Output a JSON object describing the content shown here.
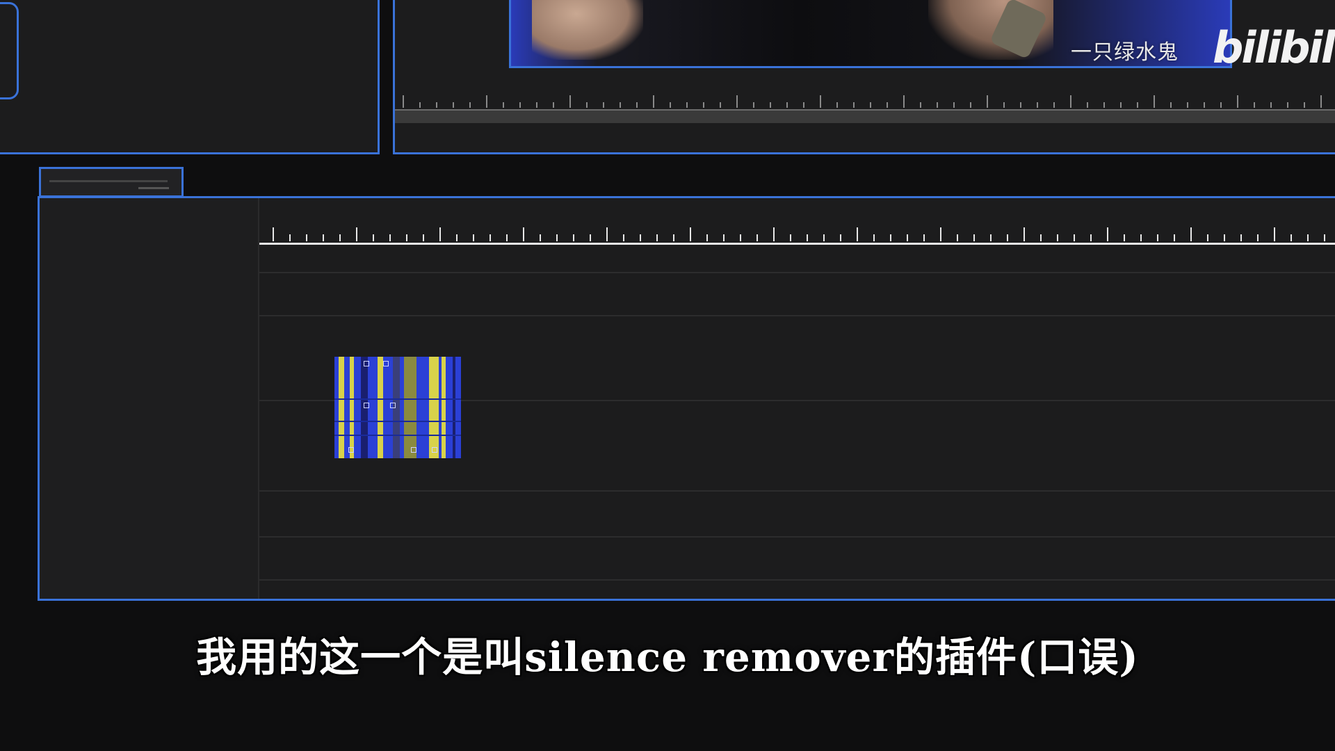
{
  "watermark": {
    "channel": "一只绿水鬼",
    "logo": "bilibili"
  },
  "subtitle": "我用的这一个是叫silence remover的插件(口误)",
  "colors": {
    "panel_border": "#3a72d8",
    "panel_bg": "#1c1c1d",
    "clip_blue": "#2b40d6",
    "clip_yellow": "#d8d24a"
  },
  "icons": {
    "bilibili_logo": "bilibili-logo-icon"
  }
}
